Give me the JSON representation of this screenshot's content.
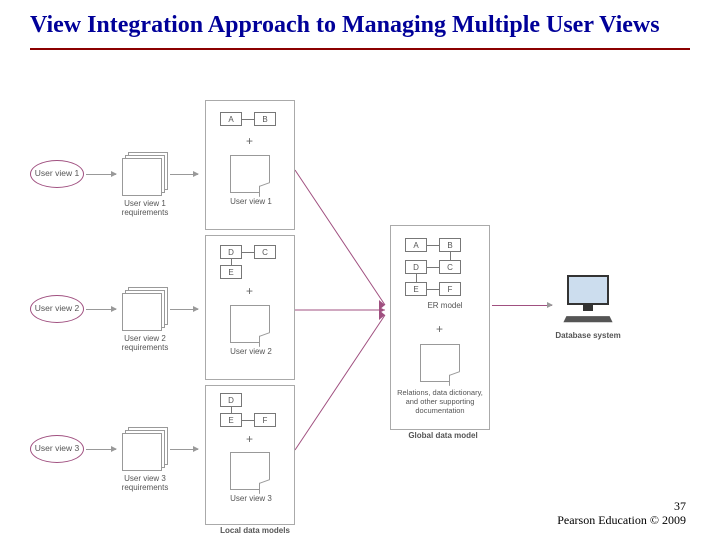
{
  "slide": {
    "title": "View Integration Approach to Managing Multiple User Views",
    "page_number": "37",
    "copyright": "Pearson Education © 2009"
  },
  "diagram": {
    "user_views": [
      {
        "ellipse": "User view 1",
        "req_label": "User view 1 requirements",
        "doc_label": "User view 1"
      },
      {
        "ellipse": "User view 2",
        "req_label": "User view 2 requirements",
        "doc_label": "User view 2"
      },
      {
        "ellipse": "User view 3",
        "req_label": "User view 3 requirements",
        "doc_label": "User view 3"
      }
    ],
    "er_group1": [
      "A",
      "B"
    ],
    "er_group2_row1": [
      "D",
      "C"
    ],
    "er_group2_row2": [
      "E"
    ],
    "er_group3_row1": [
      "D"
    ],
    "er_group3_row2": [
      "E",
      "F"
    ],
    "global_rows": [
      [
        "A",
        "B"
      ],
      [
        "D",
        "C"
      ],
      [
        "E",
        "F"
      ]
    ],
    "er_model_label": "ER model",
    "plus": "+",
    "support_doc_label": "Relations, data dictionary, and other supporting documentation",
    "global_label": "Global data model",
    "local_label": "Local data models",
    "db_label": "Database system"
  }
}
